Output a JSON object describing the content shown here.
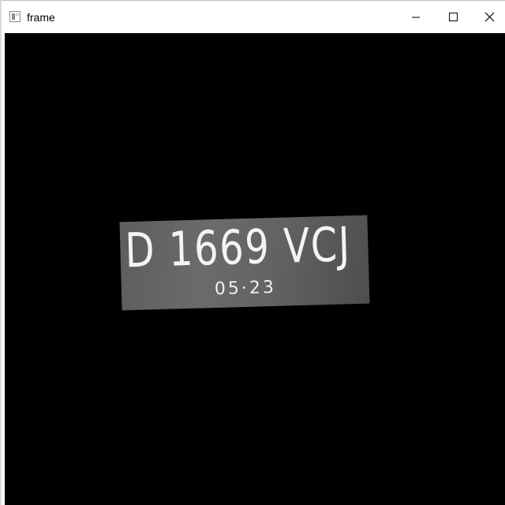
{
  "window": {
    "title": "frame",
    "controls": {
      "minimize_icon": "minimize-icon",
      "maximize_icon": "maximize-icon",
      "close_icon": "close-icon"
    }
  },
  "viewport": {
    "background_color": "#000000",
    "plate": {
      "number": "D 1669 VCJ",
      "expiry": "05·23"
    }
  }
}
